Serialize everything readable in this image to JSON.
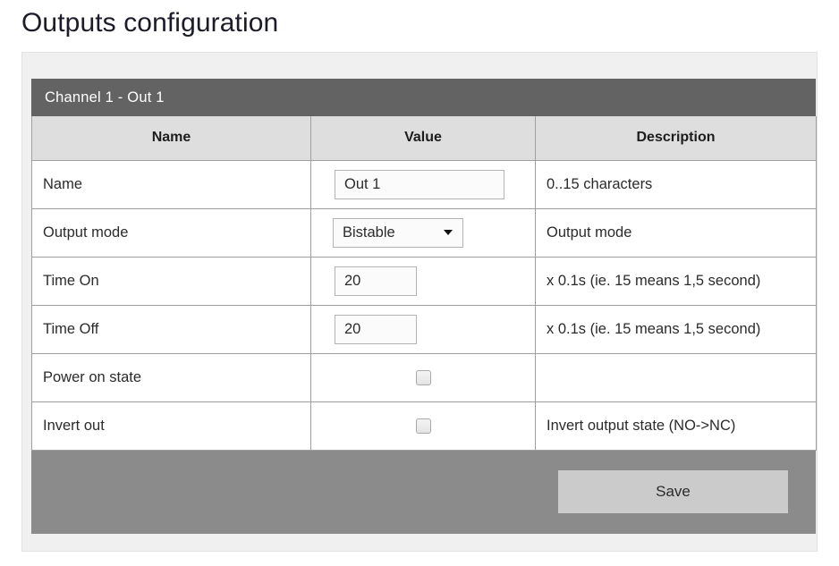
{
  "page": {
    "title": "Outputs configuration"
  },
  "card": {
    "title": "Channel 1 - Out 1",
    "columns": {
      "name": "Name",
      "value": "Value",
      "description": "Description"
    },
    "rows": [
      {
        "name": "Name",
        "control": "text",
        "value": "Out 1",
        "description": "0..15 characters"
      },
      {
        "name": "Output mode",
        "control": "select",
        "value": "Bistable",
        "description": "Output mode"
      },
      {
        "name": "Time On",
        "control": "number",
        "value": "20",
        "description": "x 0.1s (ie. 15 means 1,5 second)"
      },
      {
        "name": "Time Off",
        "control": "number",
        "value": "20",
        "description": "x 0.1s (ie. 15 means 1,5 second)"
      },
      {
        "name": "Power on state",
        "control": "checkbox",
        "value": "",
        "description": ""
      },
      {
        "name": "Invert out",
        "control": "checkbox",
        "value": "",
        "description": "Invert output state (NO->NC)"
      }
    ],
    "footer": {
      "save_label": "Save"
    }
  },
  "icons": {
    "dropdown": "chevron-down-icon",
    "checkbox": "checkbox-icon"
  },
  "colors": {
    "title_bar": "#636363",
    "footer": "#8b8b8b",
    "save_button": "#cbcbcb",
    "table_header": "#dedede",
    "panel": "#f0f0f0",
    "border": "#9f9f9f"
  }
}
